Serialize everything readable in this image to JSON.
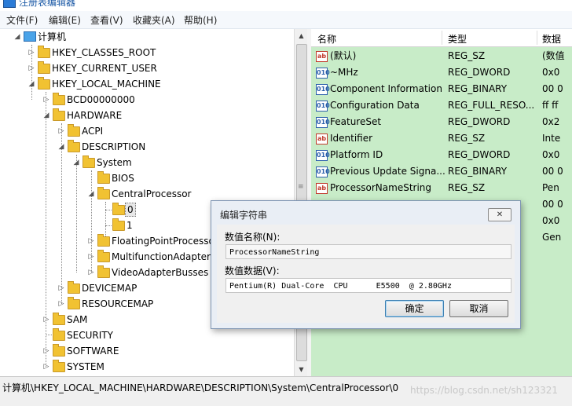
{
  "window": {
    "title": "注册表编辑器"
  },
  "menu": [
    "文件(F)",
    "编辑(E)",
    "查看(V)",
    "收藏夹(A)",
    "帮助(H)"
  ],
  "tree": {
    "root": "计算机",
    "items": [
      {
        "label": "HKEY_CLASSES_ROOT",
        "arrow": "▷"
      },
      {
        "label": "HKEY_CURRENT_USER",
        "arrow": "▷"
      },
      {
        "label": "HKEY_LOCAL_MACHINE",
        "arrow": "◢"
      },
      {
        "label": "BCD00000000",
        "arrow": "▷"
      },
      {
        "label": "HARDWARE",
        "arrow": "◢"
      },
      {
        "label": "ACPI",
        "arrow": "▷"
      },
      {
        "label": "DESCRIPTION",
        "arrow": "◢"
      },
      {
        "label": "System",
        "arrow": "◢"
      },
      {
        "label": "BIOS",
        "arrow": ""
      },
      {
        "label": "CentralProcessor",
        "arrow": "◢"
      },
      {
        "label": "0",
        "arrow": ""
      },
      {
        "label": "1",
        "arrow": ""
      },
      {
        "label": "FloatingPointProcessor",
        "arrow": "▷"
      },
      {
        "label": "MultifunctionAdapter",
        "arrow": "▷"
      },
      {
        "label": "VideoAdapterBusses",
        "arrow": "▷"
      },
      {
        "label": "DEVICEMAP",
        "arrow": "▷"
      },
      {
        "label": "RESOURCEMAP",
        "arrow": "▷"
      },
      {
        "label": "SAM",
        "arrow": "▷"
      },
      {
        "label": "SECURITY",
        "arrow": ""
      },
      {
        "label": "SOFTWARE",
        "arrow": "▷"
      },
      {
        "label": "SYSTEM",
        "arrow": "▷"
      }
    ]
  },
  "values_header": {
    "name": "名称",
    "type": "类型",
    "data": "数据"
  },
  "values": [
    {
      "icon": "ab",
      "name": "(默认)",
      "type": "REG_SZ",
      "data": "(数值"
    },
    {
      "icon": "010",
      "name": "~MHz",
      "type": "REG_DWORD",
      "data": "0x0"
    },
    {
      "icon": "010",
      "name": "Component Information",
      "type": "REG_BINARY",
      "data": "00 0"
    },
    {
      "icon": "010",
      "name": "Configuration Data",
      "type": "REG_FULL_RESO...",
      "data": "ff ff"
    },
    {
      "icon": "010",
      "name": "FeatureSet",
      "type": "REG_DWORD",
      "data": "0x2"
    },
    {
      "icon": "ab",
      "name": "Identifier",
      "type": "REG_SZ",
      "data": "Inte"
    },
    {
      "icon": "010",
      "name": "Platform ID",
      "type": "REG_DWORD",
      "data": "0x0"
    },
    {
      "icon": "010",
      "name": "Previous Update Signa...",
      "type": "REG_BINARY",
      "data": "00 0"
    },
    {
      "icon": "ab",
      "name": "ProcessorNameString",
      "type": "REG_SZ",
      "data": "Pen"
    },
    {
      "icon": "",
      "name": "",
      "type": "",
      "data": "00 0"
    },
    {
      "icon": "",
      "name": "",
      "type": "",
      "data": "0x0"
    },
    {
      "icon": "",
      "name": "",
      "type": "",
      "data": "Gen"
    }
  ],
  "statusbar": {
    "path": "计算机\\HKEY_LOCAL_MACHINE\\HARDWARE\\DESCRIPTION\\System\\CentralProcessor\\0",
    "watermark": "https://blog.csdn.net/sh123321"
  },
  "dialog": {
    "title": "编辑字符串",
    "close": "✕",
    "name_label": "数值名称(N):",
    "name_value": "ProcessorNameString",
    "data_label": "数值数据(V):",
    "data_value": "Pentium(R) Dual-Core  CPU      E5500  @ 2.80GHz",
    "ok_label": "确定",
    "cancel_label": "取消"
  },
  "colors": {
    "values_pane_bg": "#c8ecc8",
    "dialog_bg": "#e9eef5"
  }
}
